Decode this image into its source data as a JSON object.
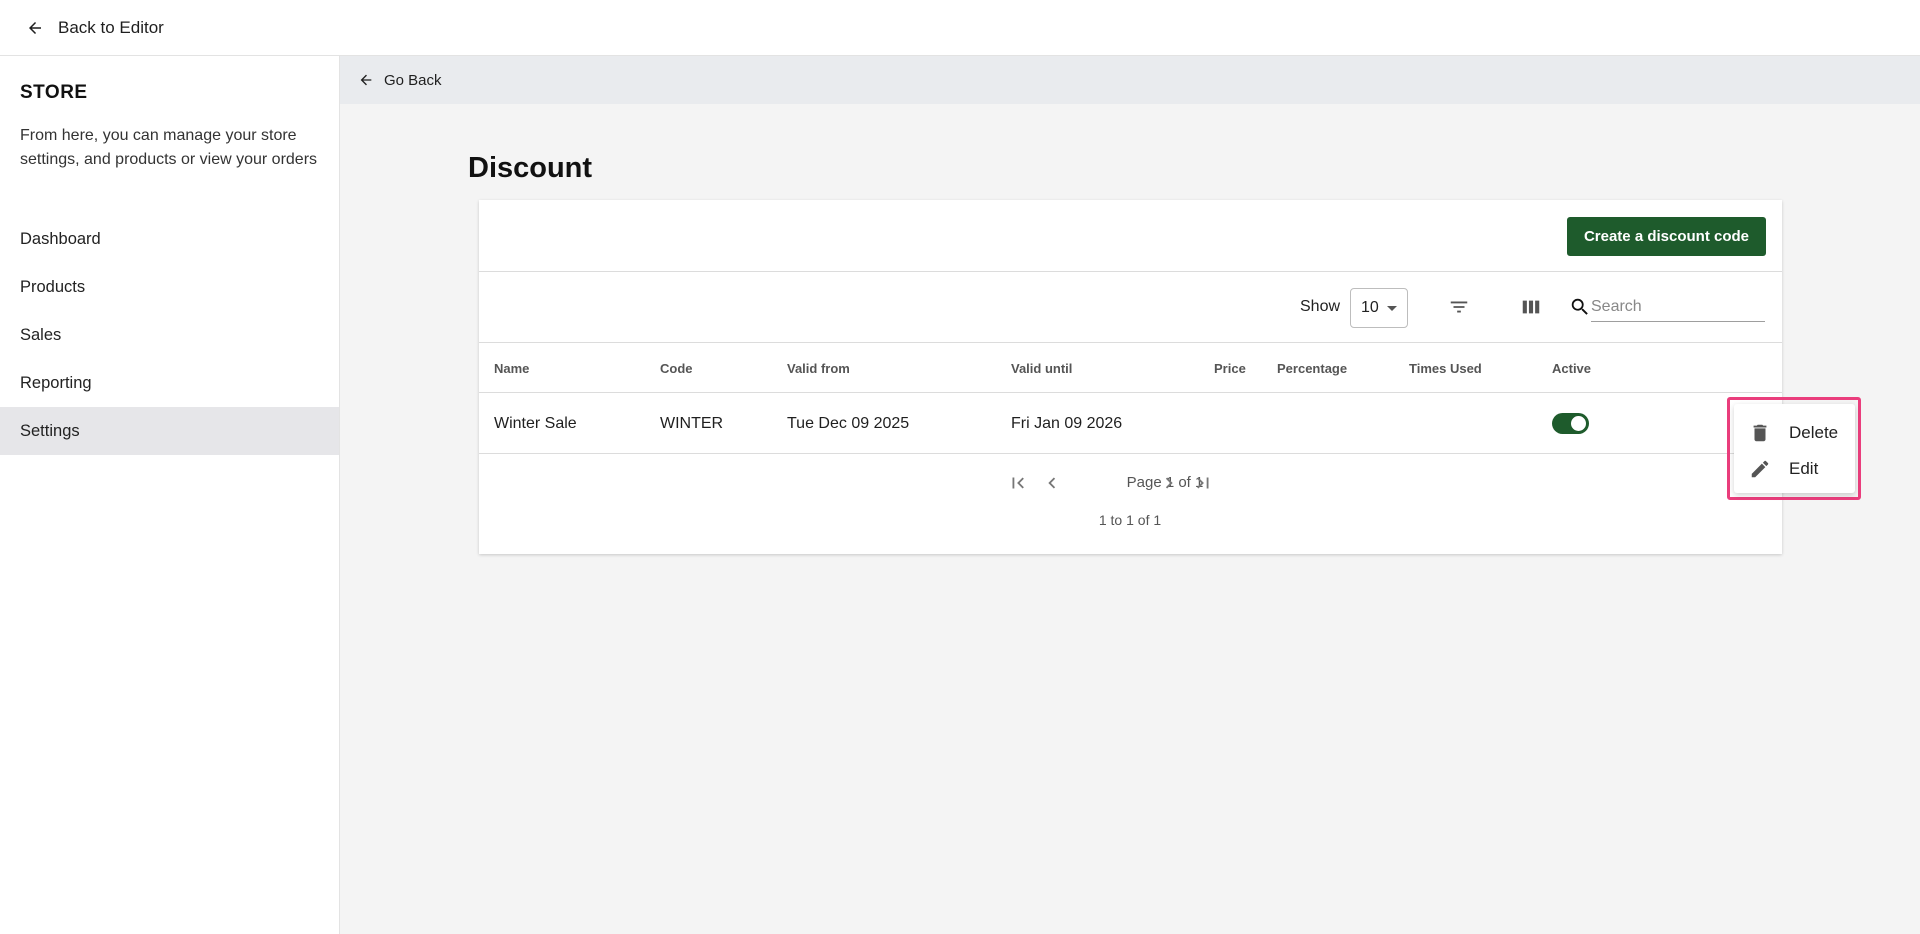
{
  "topbar": {
    "back_label": "Back to Editor"
  },
  "sidebar": {
    "title": "STORE",
    "description": "From here, you can manage your store settings, and products or view your orders",
    "items": [
      {
        "label": "Dashboard"
      },
      {
        "label": "Products"
      },
      {
        "label": "Sales"
      },
      {
        "label": "Reporting"
      },
      {
        "label": "Settings",
        "active": true
      }
    ]
  },
  "main": {
    "go_back_label": "Go Back",
    "title": "Discount",
    "create_button": "Create a discount code",
    "toolbar": {
      "show_label": "Show",
      "page_size": "10",
      "search_placeholder": "Search"
    },
    "table": {
      "columns": [
        "Name",
        "Code",
        "Valid from",
        "Valid until",
        "Price",
        "Percentage",
        "Times Used",
        "Active"
      ],
      "rows": [
        {
          "name": "Winter Sale",
          "code": "WINTER",
          "valid_from": "Tue Dec 09 2025",
          "valid_until": "Fri Jan 09 2026",
          "price": "",
          "percentage": "",
          "times_used": "",
          "active": true
        }
      ]
    },
    "pagination": {
      "page_label": "Page 1 of 1",
      "count_label": "1 to 1 of 1"
    }
  },
  "context_menu": {
    "items": [
      {
        "label": "Delete",
        "icon": "trash-icon"
      },
      {
        "label": "Edit",
        "icon": "pencil-icon"
      }
    ]
  },
  "colors": {
    "primary_green": "#1e5b2c",
    "highlight_pink": "#ea3d7c",
    "sidebar_active": "#e6e6e9",
    "main_bg": "#f4f4f4"
  }
}
